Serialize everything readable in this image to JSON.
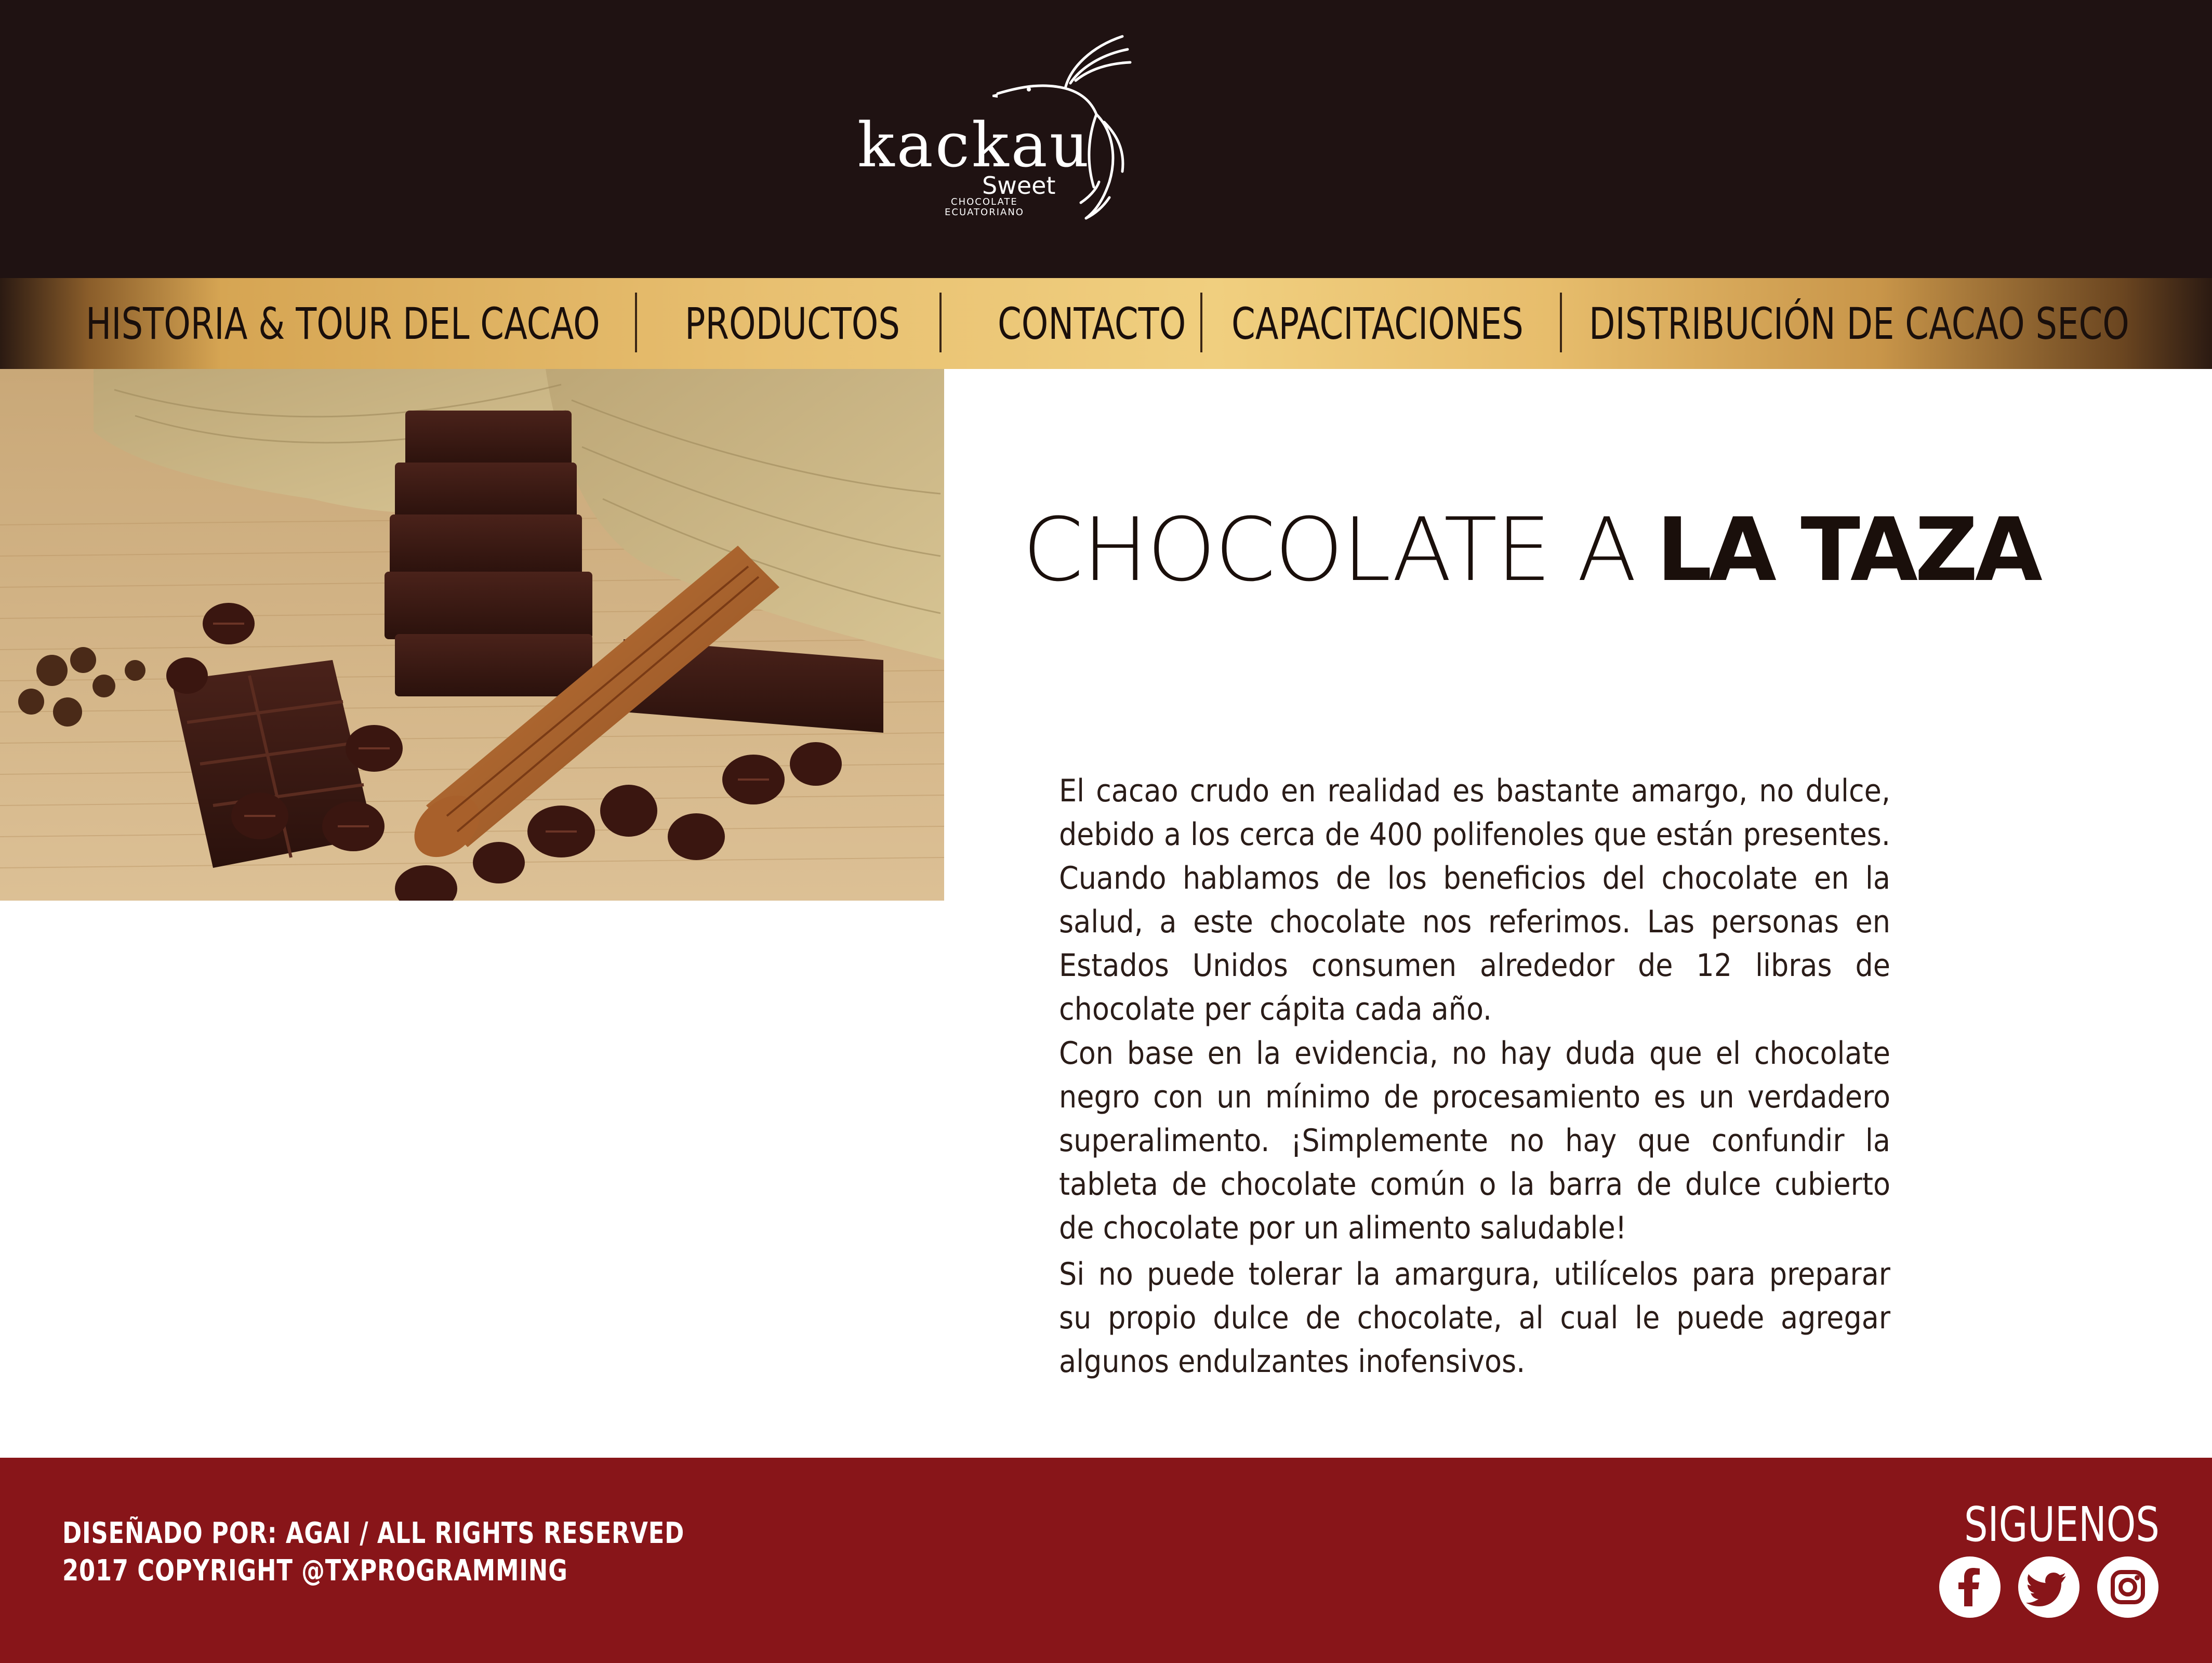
{
  "brand": {
    "name": "kackau",
    "tagline": "Sweet",
    "sub_line1": "CHOCOLATE",
    "sub_line2": "ECUATORIANO"
  },
  "nav": {
    "items": [
      {
        "label": "HISTORIA & TOUR DEL CACAO"
      },
      {
        "label": "PRODUCTOS"
      },
      {
        "label": "CONTACTO"
      },
      {
        "label": "CAPACITACIONES"
      },
      {
        "label": "DISTRIBUCIÓN DE CACAO SECO"
      }
    ]
  },
  "hero": {
    "image": "chocolate-bars-cinnamon-cacao-beans-photo"
  },
  "content": {
    "title_light": "CHOCOLATE A",
    "title_bold": "LA TAZA",
    "paragraphs": [
      "El cacao crudo en realidad es bastante amargo, no dulce, debido a los cerca de 400 polifenoles que están presentes. Cuando hablamos de los beneficios del chocolate en la salud, a este chocolate nos referimos. Las personas en Estados Unidos consumen alrededor de 12 libras de chocolate per cápita cada año.",
      "Con base en la evidencia, no hay duda que el chocolate negro con un mínimo de procesamiento es un verdadero superalimento. ¡Simplemente no hay que confundir la tableta de chocolate común o la barra de dulce cubierto de chocolate por un alimento saludable!",
      "Si no puede tolerar la amargura, utilícelos para preparar su propio dulce de chocolate, al cual le puede agregar algunos endulzantes inofensivos."
    ]
  },
  "footer": {
    "credit_line1": "DISEÑADO POR: AGAI / ALL RIGHTS RESERVED",
    "credit_line2": "2017 COPYRIGHT @TXPROGRAMMING",
    "follow_label": "SIGUENOS",
    "social": [
      {
        "icon": "facebook-icon"
      },
      {
        "icon": "twitter-icon"
      },
      {
        "icon": "instagram-icon"
      }
    ]
  },
  "colors": {
    "header_bg": "#1f1212",
    "nav_gold": "#e8c071",
    "footer_bg": "#881519",
    "text_dark": "#1a0f0b"
  }
}
